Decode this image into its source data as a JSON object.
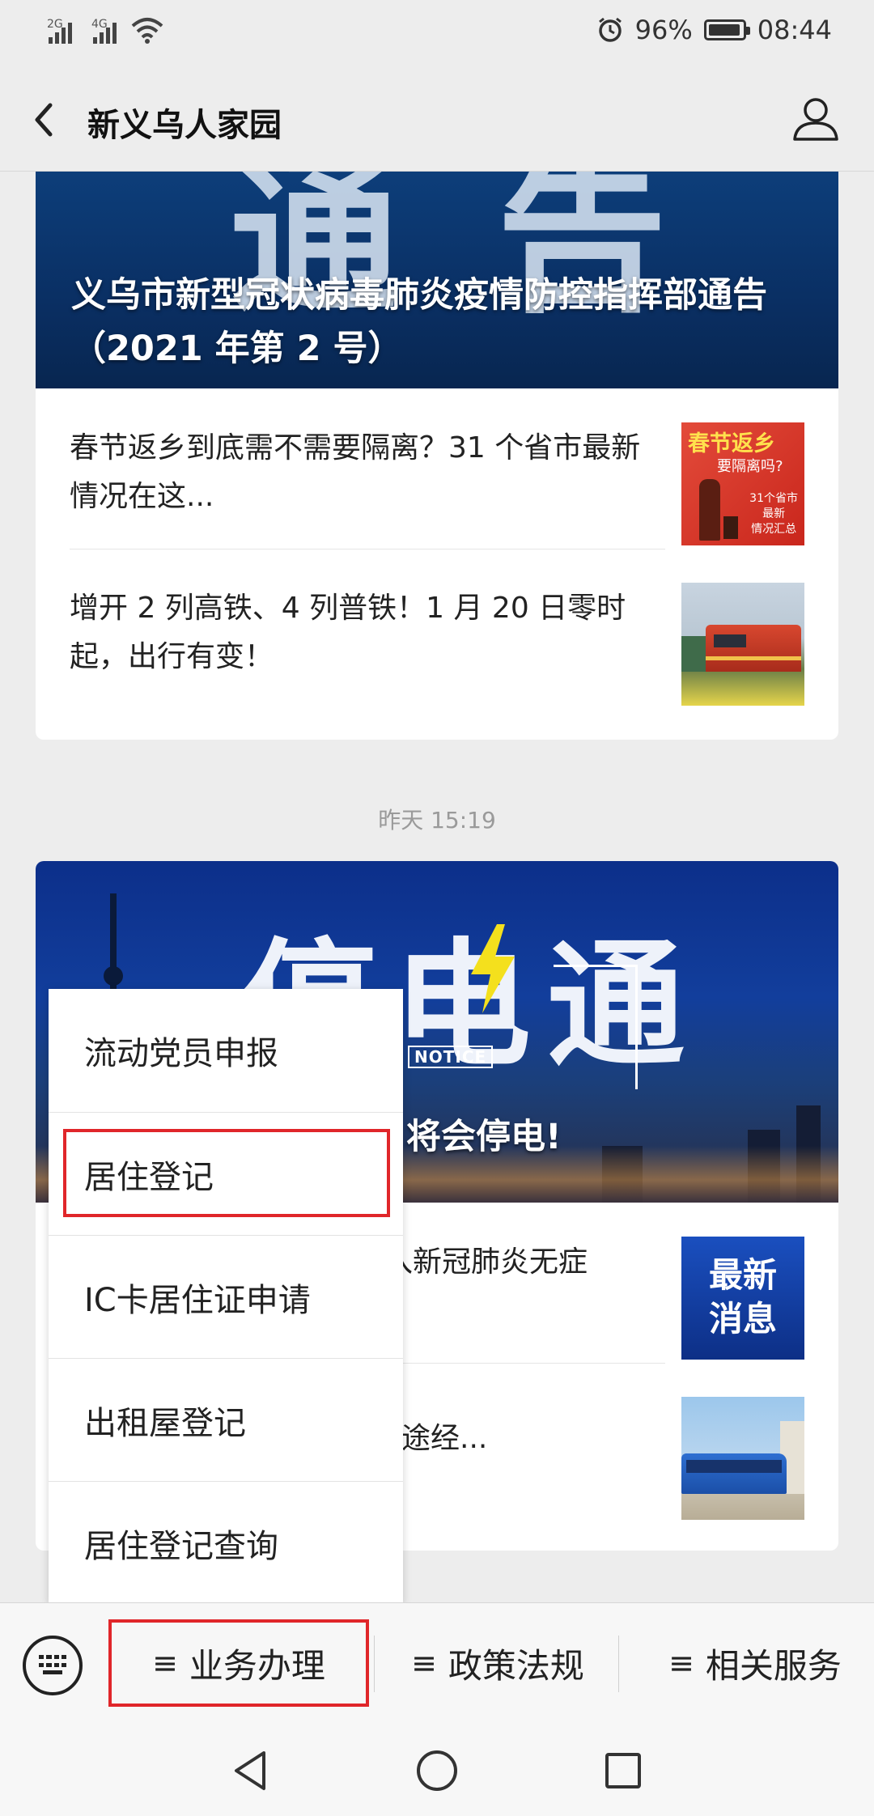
{
  "status_bar": {
    "network_1": "2G",
    "network_2": "4G",
    "battery_text": "96%",
    "battery_level": 0.96,
    "time": "08:44"
  },
  "header": {
    "title": "新义乌人家园"
  },
  "article_group_1": {
    "headline": "义乌市新型冠状病毒肺炎疫情防控指挥部通告（2021 年第 2 号）",
    "items": [
      {
        "title": "春节返乡到底需不需要隔离？31 个省市最新情况在这..."
      },
      {
        "title": "增开 2 列高铁、4 列普铁！1 月 20 日零时起，出行有变！"
      }
    ],
    "thumb_1_text": [
      "春节返乡",
      "要隔离吗?",
      "31个省市",
      "最新",
      "情况汇总"
    ]
  },
  "timestamp": "昨天 15:19",
  "article_group_2": {
    "banner_notice": "NOTICE",
    "banner_caption": "将会停电!",
    "items": [
      {
        "title": "入新冠肺炎无症"
      },
      {
        "title": "途经..."
      }
    ],
    "thumb_news_text": [
      "最新",
      "消息"
    ]
  },
  "dropdown_menu": {
    "items": [
      {
        "label": "流动党员申报"
      },
      {
        "label": "居住登记"
      },
      {
        "label": "IC卡居住证申请"
      },
      {
        "label": "出租屋登记"
      },
      {
        "label": "居住登记查询"
      }
    ],
    "highlighted_item": "居住登记"
  },
  "bottom_menu": {
    "tabs": [
      {
        "label": "业务办理"
      },
      {
        "label": "政策法规"
      },
      {
        "label": "相关服务"
      }
    ],
    "highlight_color": "#e0262a"
  }
}
